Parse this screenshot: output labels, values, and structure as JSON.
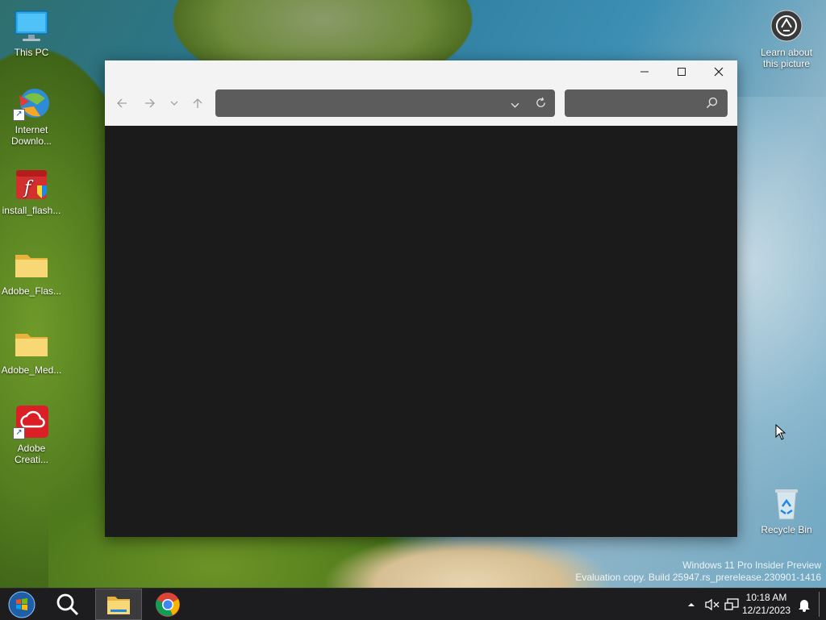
{
  "desktop": {
    "icons": [
      {
        "label": "This PC",
        "icon": "monitor-icon"
      },
      {
        "label": "Internet Downlo...",
        "icon": "idm-icon"
      },
      {
        "label": "install_flash...",
        "icon": "flash-installer-icon"
      },
      {
        "label": "Adobe_Flas...",
        "icon": "folder-icon"
      },
      {
        "label": "Adobe_Med...",
        "icon": "folder-icon"
      },
      {
        "label": "Adobe Creati...",
        "icon": "creative-cloud-icon"
      }
    ],
    "right_icons": [
      {
        "label": "Learn about this picture",
        "icon": "camera-info-icon"
      },
      {
        "label": "Recycle Bin",
        "icon": "recycle-bin-icon"
      }
    ],
    "watermark": {
      "line1": "Windows 11 Pro Insider Preview",
      "line2": "Evaluation copy. Build 25947.rs_prerelease.230901-1416"
    }
  },
  "window": {
    "address_value": "",
    "search_placeholder": ""
  },
  "taskbar": {
    "items": [
      "start-button",
      "search",
      "file-explorer",
      "chrome"
    ],
    "time": "10:18 AM",
    "date": "12/21/2023"
  }
}
